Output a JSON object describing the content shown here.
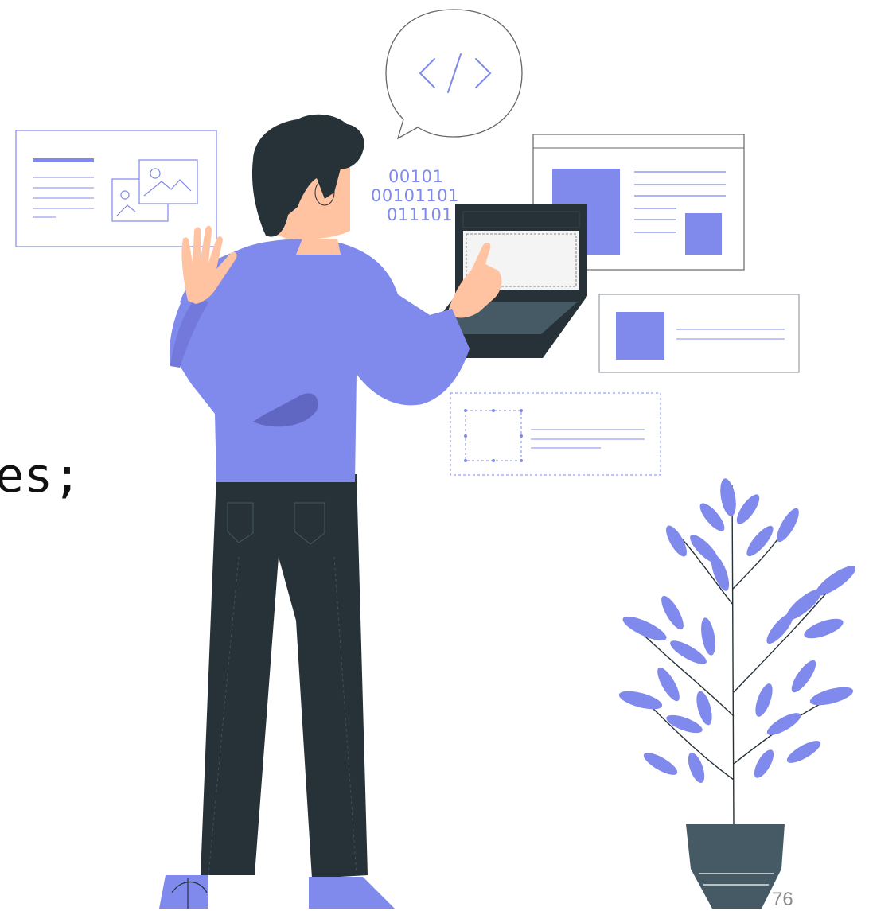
{
  "slide": {
    "body_text_fragment": "es;",
    "page_number": "76"
  },
  "illustration": {
    "code_symbol": "</>",
    "binary_lines": [
      "00101",
      "00101101",
      "011101"
    ]
  },
  "colors": {
    "accent": "#8089EC",
    "accent_dark": "#5F67C2",
    "dark": "#263238",
    "pot": "#455A64",
    "skin": "#FFC3A1",
    "line": "#9AA0A6"
  }
}
